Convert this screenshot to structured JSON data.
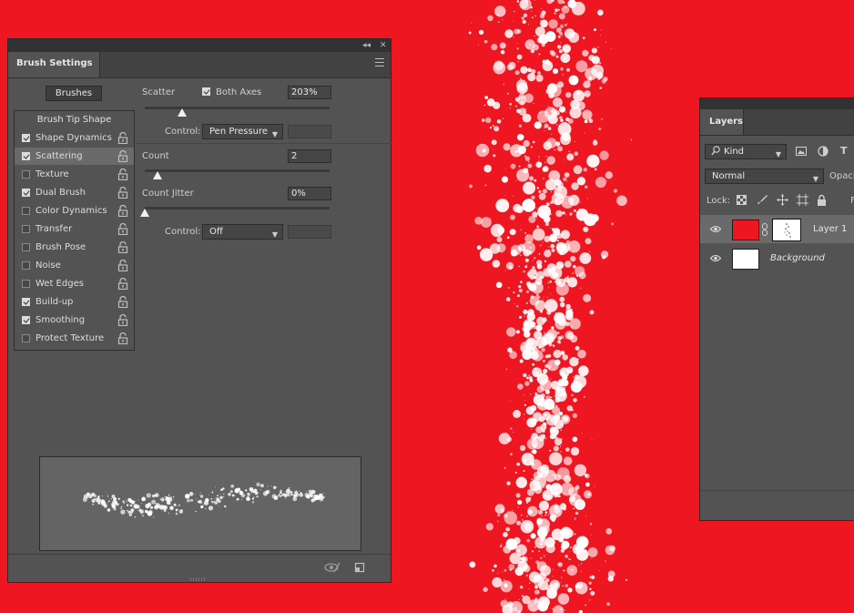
{
  "colors": {
    "canvas": "#ee1620",
    "panel": "#535353",
    "selected_row": "#6a6a6a"
  },
  "brush_settings": {
    "title": "Brush Settings",
    "brushes_button": "Brushes",
    "list_header": "Brush Tip Shape",
    "items": [
      {
        "label": "Shape Dynamics",
        "checked": true
      },
      {
        "label": "Scattering",
        "checked": true,
        "selected": true
      },
      {
        "label": "Texture",
        "checked": false
      },
      {
        "label": "Dual Brush",
        "checked": true
      },
      {
        "label": "Color Dynamics",
        "checked": false
      },
      {
        "label": "Transfer",
        "checked": false
      },
      {
        "label": "Brush Pose",
        "checked": false
      },
      {
        "label": "Noise",
        "checked": false
      },
      {
        "label": "Wet Edges",
        "checked": false
      },
      {
        "label": "Build-up",
        "checked": true
      },
      {
        "label": "Smoothing",
        "checked": true
      },
      {
        "label": "Protect Texture",
        "checked": false
      }
    ],
    "scatter": {
      "label": "Scatter",
      "both_axes_label": "Both Axes",
      "both_axes_checked": true,
      "value": "203%",
      "slider_fraction": 0.2,
      "control_label": "Control:",
      "control_value": "Pen Pressure"
    },
    "count": {
      "label": "Count",
      "value": "2",
      "slider_fraction": 0.07
    },
    "count_jitter": {
      "label": "Count Jitter",
      "value": "0%",
      "slider_fraction": 0.0,
      "control_label": "Control:",
      "control_value": "Off"
    },
    "icons": [
      "collapse-icon",
      "close-icon",
      "panel-menu-icon",
      "lock-icon",
      "toggle-preview-icon",
      "new-brush-icon"
    ]
  },
  "layers": {
    "title": "Layers",
    "filter_label": "Kind",
    "blend_mode": "Normal",
    "opacity_label": "Opaci",
    "lock_label": "Lock:",
    "fill_label_partial": "F",
    "rows": [
      {
        "name": "Layer 1",
        "thumb_color": "#ee1620",
        "selected": true,
        "has_mask": true
      },
      {
        "name": "Background",
        "thumb_color": "#ffffff",
        "selected": false,
        "italic": true
      }
    ]
  }
}
